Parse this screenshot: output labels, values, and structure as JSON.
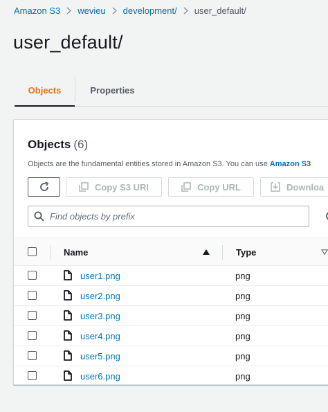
{
  "breadcrumb": {
    "items": [
      "Amazon S3",
      "wevieu",
      "development/"
    ],
    "current": "user_default/"
  },
  "page": {
    "title": "user_default/"
  },
  "tabs": [
    {
      "label": "Objects",
      "active": true
    },
    {
      "label": "Properties",
      "active": false
    }
  ],
  "objects_panel": {
    "title": "Objects",
    "count": "(6)",
    "description": "Objects are the fundamental entities stored in Amazon S3. You can use ",
    "description_link": "Amazon S3",
    "buttons": {
      "refresh_icon": "refresh-icon",
      "copy_s3_uri": "Copy S3 URI",
      "copy_url": "Copy URL",
      "download": "Downloa"
    },
    "search": {
      "placeholder": "Find objects by prefix",
      "value": ""
    },
    "table": {
      "columns": [
        "Name",
        "Type"
      ],
      "sort": {
        "column": "Name",
        "direction": "ascending"
      },
      "rows": [
        {
          "name": "user1.png",
          "type": "png"
        },
        {
          "name": "user2.png",
          "type": "png"
        },
        {
          "name": "user3.png",
          "type": "png"
        },
        {
          "name": "user4.png",
          "type": "png"
        },
        {
          "name": "user5.png",
          "type": "png"
        },
        {
          "name": "user6.png",
          "type": "png"
        }
      ]
    }
  },
  "colors": {
    "link": "#0073bb",
    "active_tab": "#ec7211",
    "disabled_text": "#aab7b8",
    "background": "#f2f3f3"
  }
}
